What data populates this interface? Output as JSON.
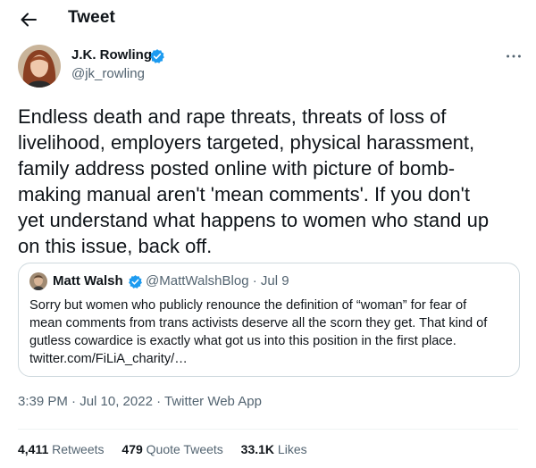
{
  "header": {
    "title": "Tweet",
    "back_icon": "arrow-left-icon"
  },
  "author": {
    "name": "J.K. Rowling",
    "handle": "@jk_rowling",
    "verified": true
  },
  "tweet": {
    "text": "Endless death and rape threats, threats of loss of\nlivelihood, employers targeted, physical harassment,\nfamily address posted online with picture of bomb-\nmaking manual aren't 'mean comments'. If you don't\nyet understand what happens to women who stand up\non this issue, back off."
  },
  "quoted": {
    "name": "Matt Walsh",
    "verified": true,
    "meta": "@MattWalshBlog · Jul 9",
    "text": "Sorry but women who publicly renounce the definition of “woman” for fear of\nmean comments from trans activists deserve all the scorn they get. That kind of\ngutless cowardice is exactly what got us into this position in the first place.\ntwitter.com/FiLiA_charity/…"
  },
  "timestamp": "3:39 PM · Jul 10, 2022 · Twitter Web App",
  "stats": {
    "retweets_count": "4,411",
    "retweets_label": " Retweets",
    "quotes_count": "479",
    "quotes_label": " Quote Tweets",
    "likes_count": "33.1K",
    "likes_label": " Likes"
  },
  "colors": {
    "verified": "#1d9bf0",
    "secondary_text": "#536471",
    "border": "#cfd9de"
  }
}
